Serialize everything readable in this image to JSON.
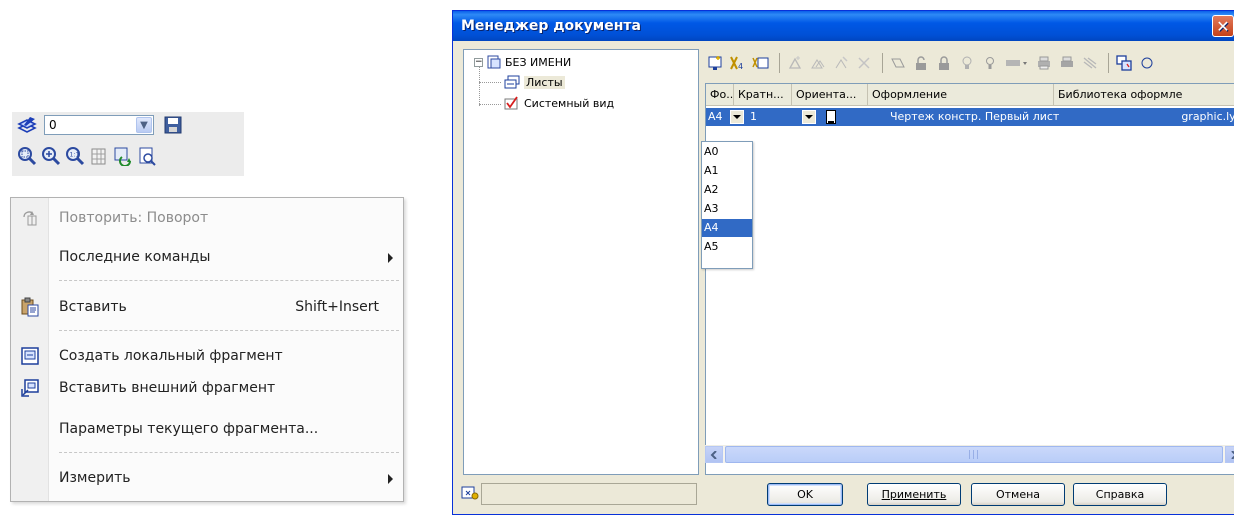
{
  "toolbar": {
    "layer_value": "0"
  },
  "context_menu": {
    "items": [
      {
        "label": "Повторить: Поворот",
        "disabled": true
      },
      {
        "label": "Последние команды",
        "submenu": true
      },
      {
        "label": "Вставить",
        "shortcut": "Shift+Insert"
      },
      {
        "label": "Создать локальный фрагмент"
      },
      {
        "label": "Вставить внешний фрагмент"
      },
      {
        "label": "Параметры текущего фрагмента..."
      },
      {
        "label": "Измерить",
        "submenu": true
      }
    ]
  },
  "dialog": {
    "title": "Менеджер документа",
    "tree": {
      "root": "БЕЗ ИМЕНИ",
      "children": [
        "Листы",
        "Системный вид"
      ]
    },
    "grid": {
      "columns": [
        "Фо...",
        "Кратн...",
        "Ориента...",
        "Оформление",
        "Библиотека оформле"
      ],
      "row": {
        "format": "A4",
        "multiplicity": "1",
        "design": "Чертеж констр. Первый лист",
        "library": "graphic.lyt"
      },
      "format_options": [
        "A0",
        "A1",
        "A2",
        "A3",
        "A4",
        "A5"
      ],
      "selected_format": "A4"
    },
    "buttons": {
      "ok": "OK",
      "apply": "Применить",
      "cancel": "Отмена",
      "help": "Справка"
    }
  },
  "colors": {
    "title_bar": "#0058e6",
    "selection": "#316ac5",
    "dialog_bg": "#ece9d8"
  }
}
